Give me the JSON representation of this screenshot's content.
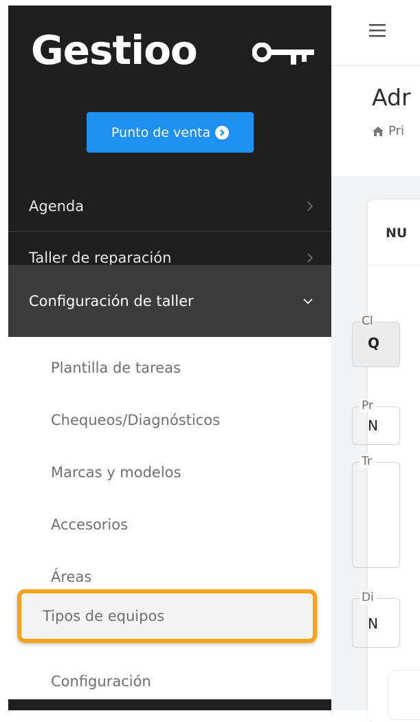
{
  "brand": {
    "name": "Gestioo"
  },
  "sidebar": {
    "pos_button": "Punto de venta",
    "items": [
      {
        "label": "Agenda"
      },
      {
        "label": "Taller de reparación"
      },
      {
        "label": "Configuración de taller"
      }
    ],
    "submenu": [
      "Plantilla de tareas",
      "Chequeos/Diagnósticos",
      "Marcas y modelos",
      "Accesorios",
      "Áreas",
      "Tipos de equipos",
      "Configuración"
    ],
    "highlighted": "Tipos de equipos"
  },
  "main": {
    "title": "Adr",
    "breadcrumb": "Pri",
    "card_title": "NU",
    "fields": [
      {
        "label": "Cl",
        "value": "Q"
      },
      {
        "label": "Pr",
        "value": "N"
      },
      {
        "label": "Tr",
        "value": ""
      },
      {
        "label": "Di",
        "value": "N"
      }
    ]
  },
  "colors": {
    "sidebar_bg": "#1f1f1f",
    "active_item_bg": "#3b3b3b",
    "button_blue": "#1e90f0",
    "highlight_orange": "#f4a41d"
  },
  "icons": [
    "key-icon",
    "arrow-circle-right-icon",
    "chevron-right-icon",
    "chevron-down-icon",
    "hamburger-menu-icon",
    "home-icon"
  ]
}
